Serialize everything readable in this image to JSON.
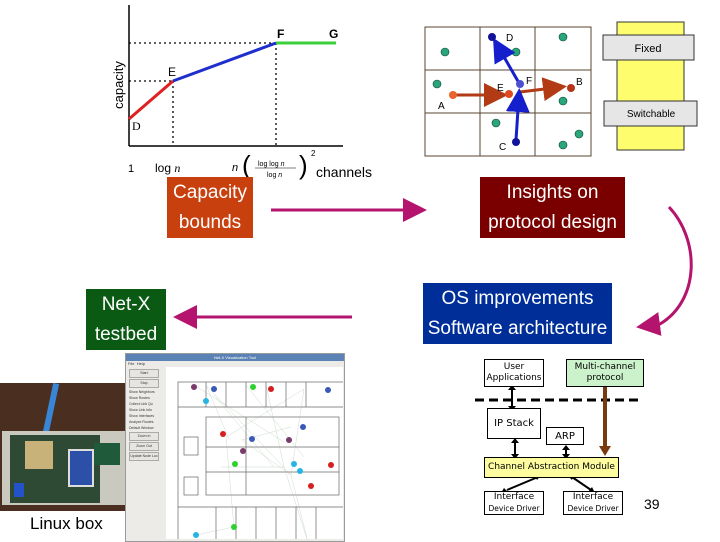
{
  "slide_number": "39",
  "capacity_chart": {
    "ylabel": "capacity",
    "xlabel": "channels",
    "x_ticks": [
      "1",
      "log n",
      "n (log log n / log n)^2"
    ],
    "points": [
      "D",
      "E",
      "F",
      "G"
    ],
    "segments": [
      {
        "from": "D",
        "to": "E",
        "color": "#e02020"
      },
      {
        "from": "E",
        "to": "F",
        "color": "#1f2fcc"
      },
      {
        "from": "F",
        "to": "G",
        "color": "#3ccf3c"
      }
    ]
  },
  "routing_diagram": {
    "labels": {
      "A": "A",
      "B": "B",
      "C": "C",
      "D": "D",
      "E": "E",
      "F": "F"
    },
    "interface_labels": {
      "fixed": "Fixed",
      "switchable": "Switchable"
    }
  },
  "flow": {
    "capacity_bounds": [
      "Capacity",
      "bounds"
    ],
    "insights": [
      "Insights on",
      "protocol design"
    ],
    "os_improvements": [
      "OS improvements",
      "Software architecture"
    ],
    "netx_testbed": [
      "Net-X",
      "testbed"
    ],
    "colors": {
      "capacity_bounds": "#c9400f",
      "insights": "#7a0000",
      "os_improvements": "#002e99",
      "netx_testbed": "#0a5a14",
      "arrow": "#b5146e"
    }
  },
  "architecture": {
    "user_applications": [
      "User",
      "Applications"
    ],
    "multichannel_protocol": [
      "Multi-channel",
      "protocol"
    ],
    "ip_stack": "IP Stack",
    "arp": "ARP",
    "channel_abstraction": "Channel Abstraction Module",
    "interface1": [
      "Interface",
      "Device Driver"
    ],
    "interface2": [
      "Interface",
      "Device Driver"
    ]
  },
  "testbed": {
    "linux_box_label": "Linux box",
    "app_title": "Net-X Visualization Tool",
    "menu": [
      "File",
      "Help"
    ],
    "buttons": [
      "Start",
      "Stop"
    ],
    "checkboxes": [
      "Show Neighbors",
      "Show Routes",
      "Collect Link Qu",
      "Show Link Info",
      "Show Interfaces",
      "Analyze Routes",
      "Default Window"
    ],
    "actions": [
      "Zoom In",
      "Zoom Out",
      "Update Node Loc"
    ]
  }
}
